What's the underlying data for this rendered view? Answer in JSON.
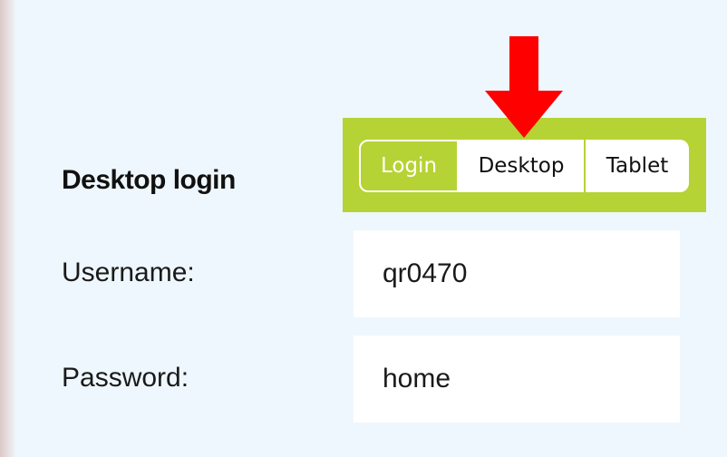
{
  "page": {
    "title": "Desktop login"
  },
  "mode_switch": {
    "items": [
      {
        "label": "Login",
        "state": "active-outlined"
      },
      {
        "label": "Desktop",
        "state": "default"
      },
      {
        "label": "Tablet",
        "state": "default"
      }
    ],
    "accent_color": "#b5d334",
    "highlight_arrow_color": "#ff0000"
  },
  "form": {
    "username": {
      "label": "Username:",
      "value": "qr0470"
    },
    "password": {
      "label": "Password:",
      "value": "home"
    }
  }
}
